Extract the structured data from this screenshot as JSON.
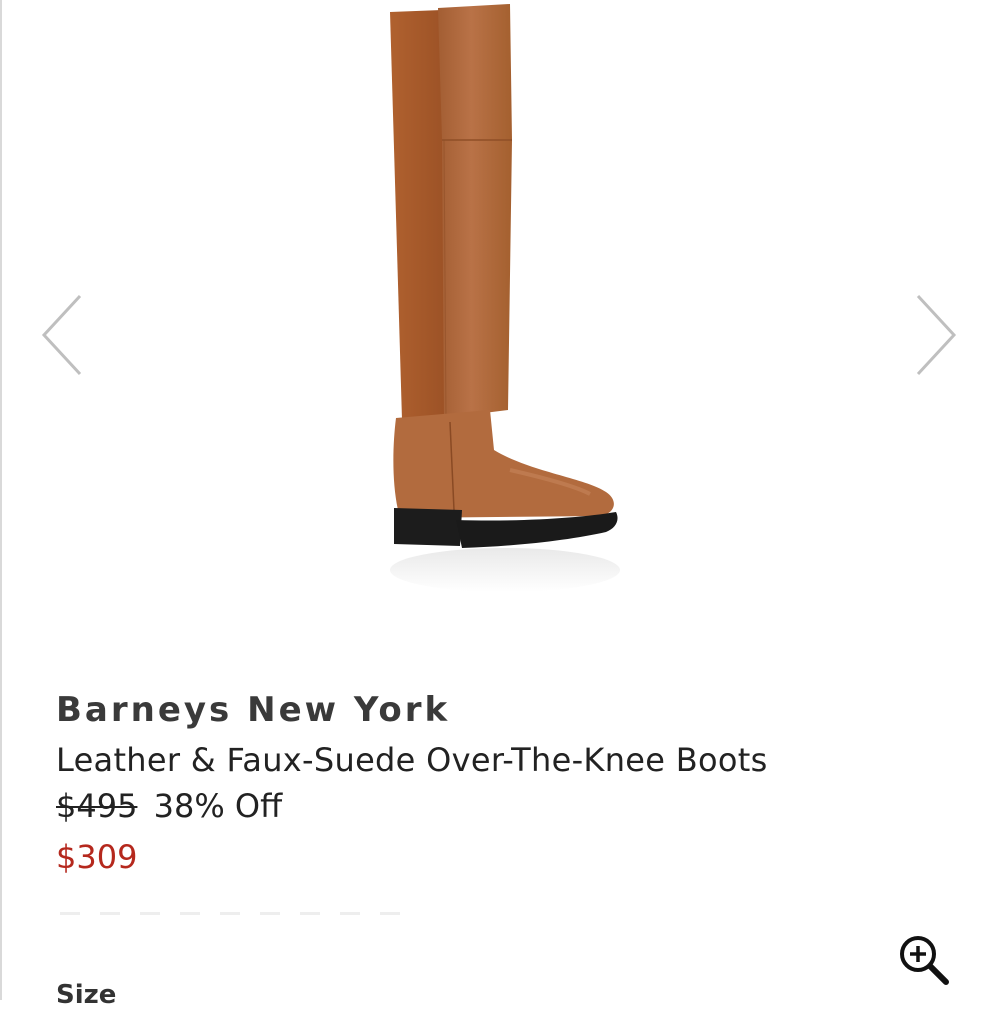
{
  "product": {
    "brand": "Barneys New York",
    "name": "Leather & Faux-Suede Over-The-Knee Boots",
    "original_price": "$495",
    "discount": "38% Off",
    "sale_price": "$309"
  },
  "size_section": {
    "label": "Size"
  },
  "icons": {
    "prev": "chevron-left-icon",
    "next": "chevron-right-icon",
    "zoom": "zoom-in-icon"
  },
  "colors": {
    "sale_price": "#b5281d",
    "boot_leather": "#b0683b",
    "boot_suede": "#a85a2e",
    "sole": "#1a1a1a"
  }
}
